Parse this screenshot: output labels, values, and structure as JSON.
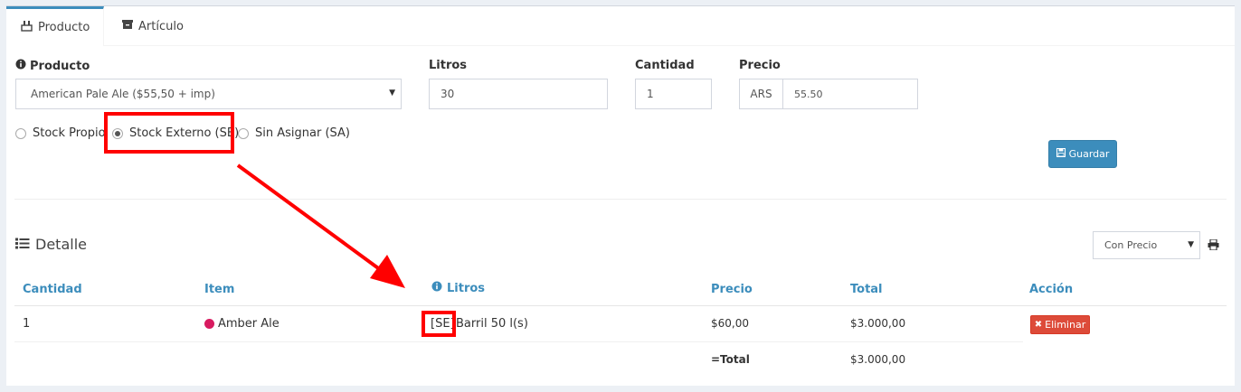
{
  "tabs": [
    {
      "label": "Producto",
      "icon": "beer-crate-icon",
      "active": true
    },
    {
      "label": "Artículo",
      "icon": "archive-icon",
      "active": false
    }
  ],
  "form": {
    "producto_label": "Producto",
    "producto_value": "American Pale Ale ($55,50 + imp)",
    "litros_label": "Litros",
    "litros_value": "30",
    "cantidad_label": "Cantidad",
    "cantidad_value": "1",
    "precio_label": "Precio",
    "precio_currency": "ARS",
    "precio_value": "55.50",
    "radios": [
      {
        "label": "Stock Propio",
        "checked": false
      },
      {
        "label": "Stock Externo (SE)",
        "checked": true
      },
      {
        "label": "Sin Asignar (SA)",
        "checked": false
      }
    ],
    "save_label": "Guardar"
  },
  "detalle": {
    "title": "Detalle",
    "price_mode": "Con Precio",
    "columns": [
      "Cantidad",
      "Item",
      "Litros",
      "Precio",
      "Total",
      "Acción"
    ],
    "rows": [
      {
        "cantidad": "1",
        "item": "Amber Ale",
        "item_color": "#d81b60",
        "tag": "[SE]",
        "litros": "Barril 50 l(s)",
        "precio": "$60,00",
        "total": "$3.000,00",
        "action": "Eliminar"
      }
    ],
    "total_label": "=Total",
    "total_value": "$3.000,00"
  },
  "colors": {
    "accent": "#3c8dbc",
    "danger": "#dd4b39",
    "annotation": "#ff0000"
  }
}
